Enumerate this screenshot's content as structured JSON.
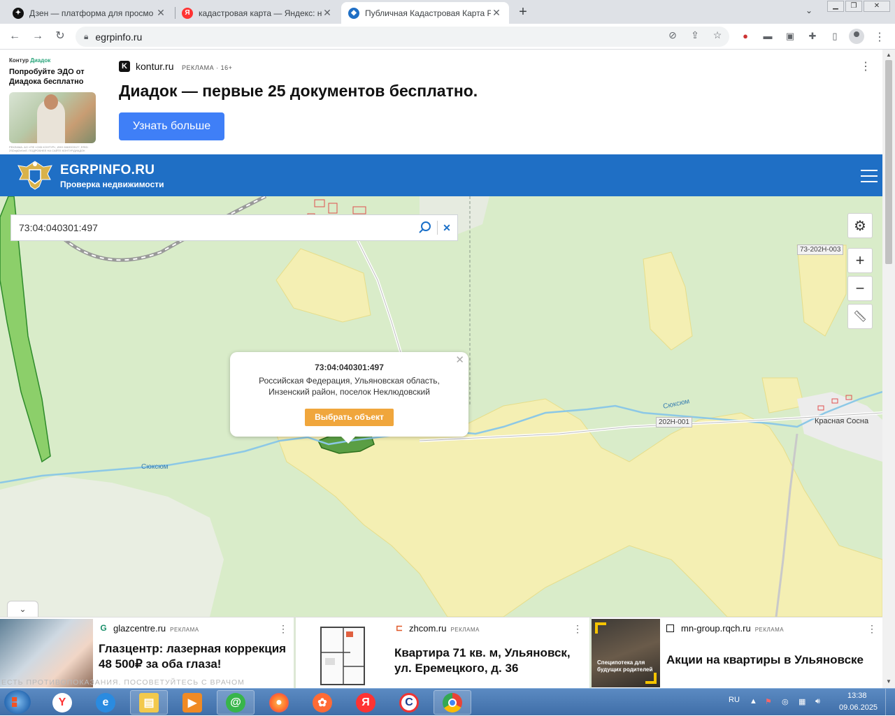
{
  "browser": {
    "tabs": [
      {
        "title": "Дзен — платформа для просмо",
        "favicon": "dzen-icon",
        "active": false
      },
      {
        "title": "кадастровая карта — Яндекс: на",
        "favicon": "yandex-icon",
        "active": false
      },
      {
        "title": "Публичная Кадастровая Карта Р",
        "favicon": "shield-icon",
        "active": true
      }
    ],
    "url": "egrpinfo.ru"
  },
  "top_ad": {
    "left_brand": "Контур",
    "left_brand_accent": "Диадок",
    "left_title": "Попробуйте ЭДО от Диадока бесплатно",
    "left_fine": "РЕКЛАМА. АО «ПФ «СКБ КОНТУР», ИНН 6663003127, ERID: 2SDnjd2xKmE. ПОДРОБНЕЕ НА САЙТЕ КОНТУР.ДИАДОК",
    "source": "kontur.ru",
    "source_label": "РЕКЛАМА · 16+",
    "headline": "Диадок — первые 25 документов бесплатно.",
    "cta": "Узнать больше"
  },
  "site": {
    "name": "EGRPINFO.RU",
    "tagline": "Проверка недвижимости"
  },
  "map": {
    "search_value": "73:04:040301:497",
    "popup": {
      "cad_number": "73:04:040301:497",
      "address_line1": "Российская Федерация, Ульяновская область,",
      "address_line2": "Инзенский район, поселок Неклюдовский",
      "button": "Выбрать объект"
    },
    "labels": {
      "river1": "Сюксюм",
      "river2": "Сюксюм",
      "village": "Красная Сосна",
      "road1": "202Н-001",
      "road2": "73-202Н-003"
    }
  },
  "bottom_ads": [
    {
      "source": "glazcentre.ru",
      "label": "РЕКЛАМА",
      "title": "Глазцентр: лазерная коррекция 48 500₽ за оба глаза!",
      "warning": "ЕСТЬ ПРОТИВОПОКАЗАНИЯ. ПОСОВЕТУЙТЕСЬ С ВРАЧОМ"
    },
    {
      "source": "zhcom.ru",
      "label": "РЕКЛАМА",
      "title": "Квартира 71 кв. м, Ульяновск, ул. Еремецкого, д. 36"
    },
    {
      "source": "mn-group.rqch.ru",
      "label": "РЕКЛАМА",
      "title": "Акции на квартиры в Ульяновске",
      "image_text": "Специпотека для будущих родителей"
    }
  ],
  "taskbar": {
    "lang": "RU",
    "time": "13:38",
    "date": "09.06.2025"
  },
  "colors": {
    "site_header": "#1f6fc5",
    "cta_blue": "#3f7ff7",
    "popup_button": "#f0a63c",
    "forest": "#a6d58d",
    "field": "#f4efb3"
  }
}
